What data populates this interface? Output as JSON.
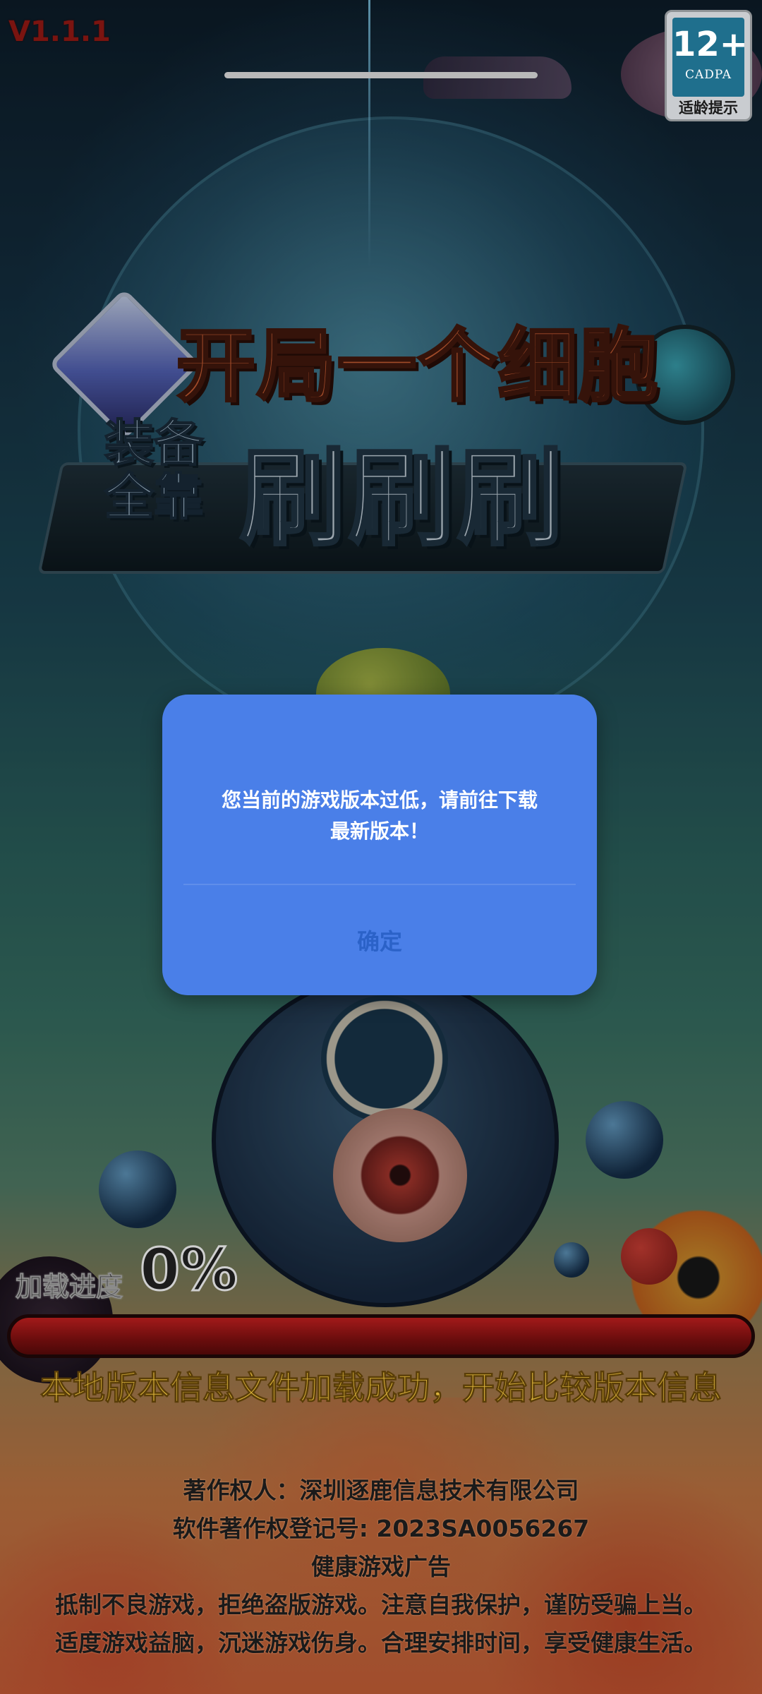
{
  "version": "V1.1.1",
  "age_rating": {
    "number": "12+",
    "org": "CADPA",
    "caption": "适龄提示"
  },
  "logo": {
    "line1": "开局一个细胞",
    "line2a": "装备",
    "line2b": "全靠",
    "line3": "刷刷刷"
  },
  "dialog": {
    "message_line1": "您当前的游戏版本过低，请前往下载",
    "message_line2": "最新版本！",
    "confirm_label": "确定"
  },
  "loading": {
    "label": "加载进度",
    "percent_text": "0%",
    "progress": 0,
    "status": "本地版本信息文件加载成功，开始比较版本信息"
  },
  "footer": {
    "copyright_owner": "著作权人：深圳逐鹿信息技术有限公司",
    "registration": "软件著作权登记号: 2023SA0056267",
    "health_title": "健康游戏广告",
    "health_line1": "抵制不良游戏，拒绝盗版游戏。注意自我保护，谨防受骗上当。",
    "health_line2": "适度游戏益脑，沉迷游戏伤身。合理安排时间，享受健康生活。"
  },
  "colors": {
    "dialog_bg": "#4a7fe8",
    "confirm_text": "#2b62c8",
    "progress_track": "#8a1414",
    "status_text": "#d8b03a",
    "version_text": "#7a1410"
  }
}
